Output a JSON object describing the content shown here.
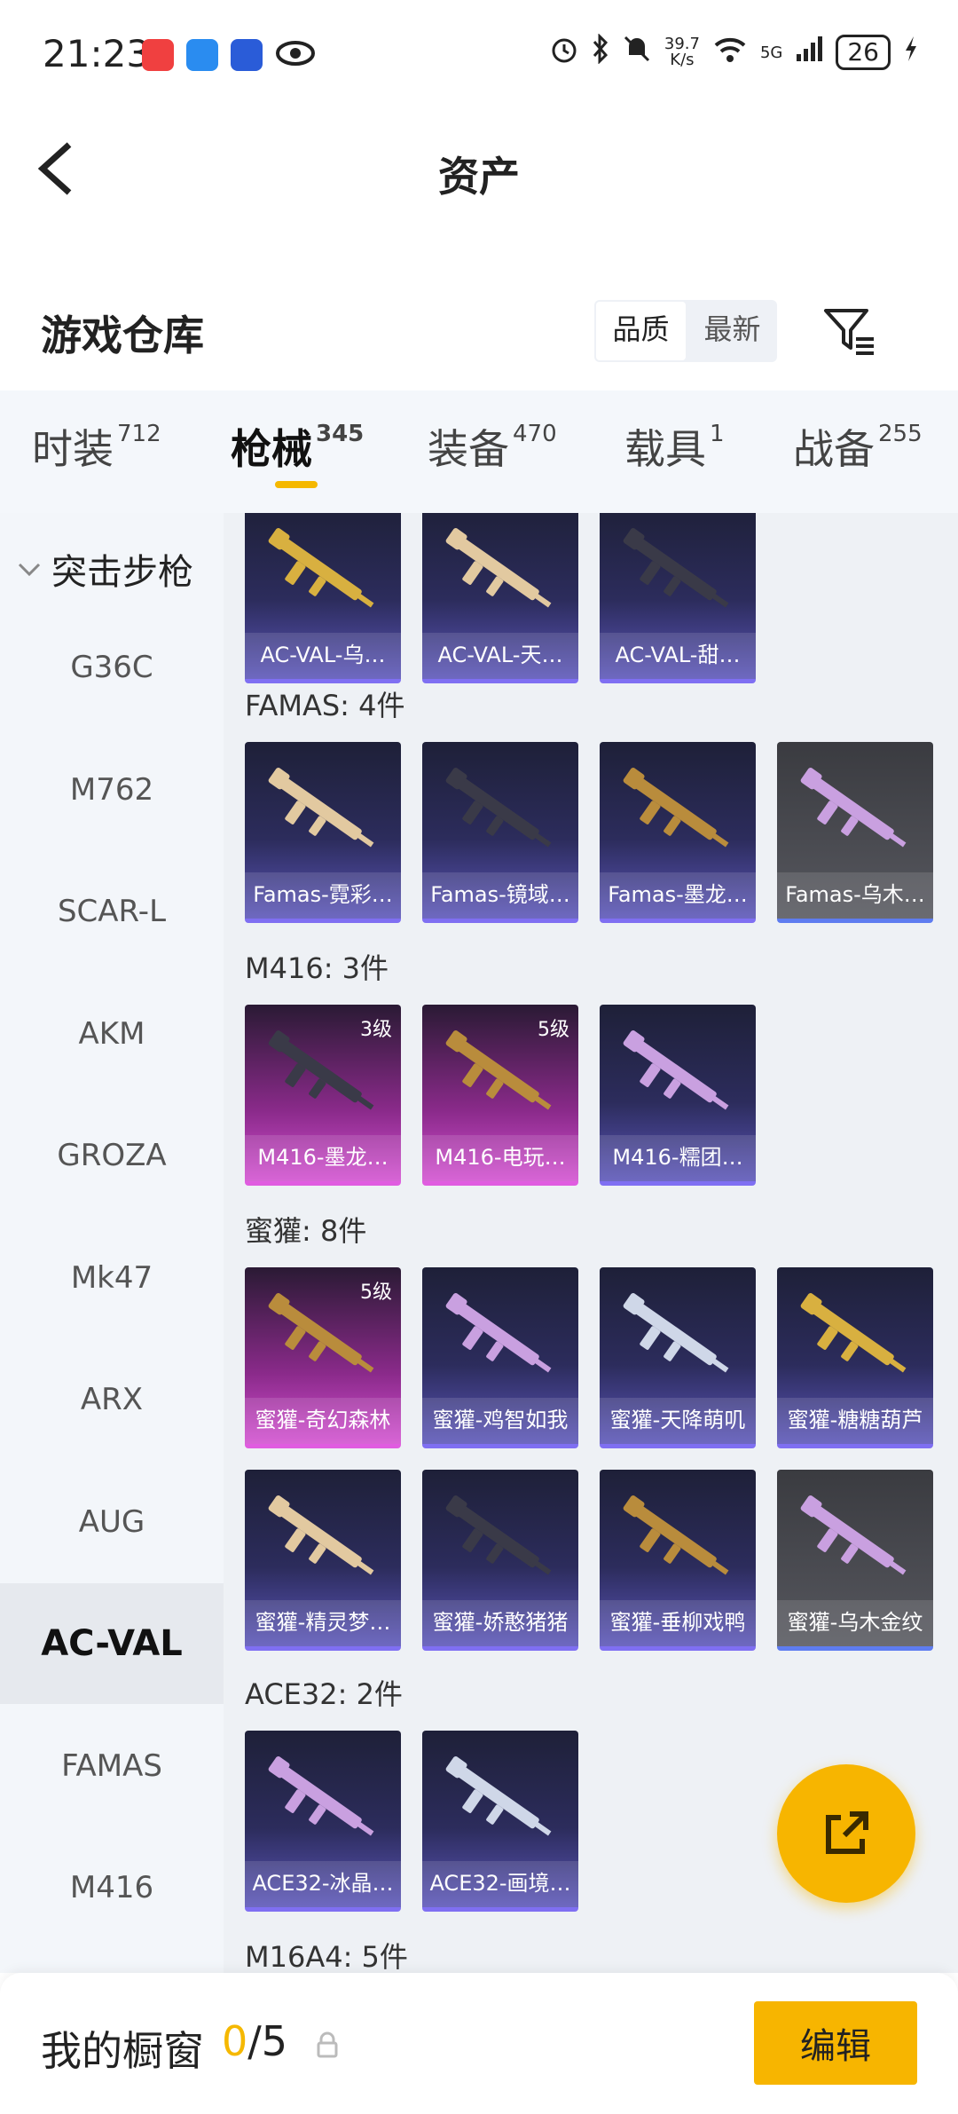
{
  "status_bar": {
    "time": "21:23",
    "net_speed_value": "39.7",
    "net_speed_unit": "K/s",
    "network": "5G",
    "battery": "26"
  },
  "header": {
    "title": "资产"
  },
  "section": {
    "title": "游戏仓库",
    "sort_options": [
      "品质",
      "最新"
    ],
    "active_sort": "品质"
  },
  "tabs": [
    {
      "label": "时装",
      "count": "712"
    },
    {
      "label": "枪械",
      "count": "345"
    },
    {
      "label": "装备",
      "count": "470"
    },
    {
      "label": "载具",
      "count": "1"
    },
    {
      "label": "战备",
      "count": "255"
    }
  ],
  "active_tab": "枪械",
  "sidebar": {
    "group": "突击步枪",
    "items": [
      "G36C",
      "M762",
      "SCAR-L",
      "AKM",
      "GROZA",
      "Mk47",
      "ARX",
      "AUG",
      "AC-VAL",
      "FAMAS",
      "M416"
    ],
    "active": "AC-VAL"
  },
  "groups": [
    {
      "label": "",
      "items": [
        {
          "name": "AC-VAL-乌…",
          "style": "blue",
          "level": ""
        },
        {
          "name": "AC-VAL-天…",
          "style": "blue",
          "level": ""
        },
        {
          "name": "AC-VAL-甜…",
          "style": "blue",
          "level": ""
        }
      ]
    },
    {
      "label": "FAMAS: 4件",
      "items": [
        {
          "name": "Famas-霓彩…",
          "style": "blue",
          "level": ""
        },
        {
          "name": "Famas-镜域…",
          "style": "blue",
          "level": ""
        },
        {
          "name": "Famas-墨龙…",
          "style": "blue",
          "level": ""
        },
        {
          "name": "Famas-乌木…",
          "style": "grey",
          "level": ""
        }
      ]
    },
    {
      "label": "M416: 3件",
      "items": [
        {
          "name": "M416-墨龙…",
          "style": "pink",
          "level": "3级"
        },
        {
          "name": "M416-电玩…",
          "style": "pink",
          "level": "5级"
        },
        {
          "name": "M416-糯团…",
          "style": "blue",
          "level": ""
        }
      ]
    },
    {
      "label": "蜜獾: 8件",
      "items": [
        {
          "name": "蜜獾-奇幻森林",
          "style": "pink",
          "level": "5级"
        },
        {
          "name": "蜜獾-鸡智如我",
          "style": "blue",
          "level": ""
        },
        {
          "name": "蜜獾-天降萌叽",
          "style": "blue",
          "level": ""
        },
        {
          "name": "蜜獾-糖糖葫芦",
          "style": "blue",
          "level": ""
        },
        {
          "name": "蜜獾-精灵梦…",
          "style": "blue",
          "level": ""
        },
        {
          "name": "蜜獾-娇憨猪猪",
          "style": "blue",
          "level": ""
        },
        {
          "name": "蜜獾-垂柳戏鸭",
          "style": "blue",
          "level": ""
        },
        {
          "name": "蜜獾-乌木金纹",
          "style": "grey",
          "level": ""
        }
      ]
    },
    {
      "label": "ACE32: 2件",
      "items": [
        {
          "name": "ACE32-冰晶…",
          "style": "blue",
          "level": ""
        },
        {
          "name": "ACE32-画境…",
          "style": "blue",
          "level": ""
        }
      ]
    },
    {
      "label": "M16A4: 5件",
      "items": []
    }
  ],
  "bottom_bar": {
    "label": "我的橱窗",
    "current": "0",
    "total": "/5",
    "edit_label": "编辑"
  },
  "colors": {
    "accent": "#f7b500",
    "card_blue": "#5a54b8",
    "card_pink": "#d24fd0",
    "card_grey": "#56575e"
  }
}
